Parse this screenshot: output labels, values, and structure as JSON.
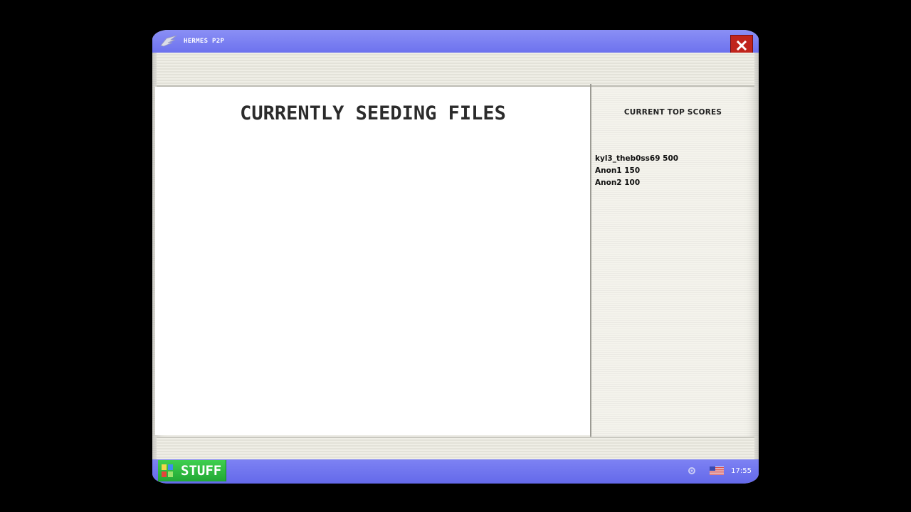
{
  "window": {
    "title": "HERMES P2P",
    "app_icon": "wing-icon",
    "close_icon": "close-icon"
  },
  "main": {
    "heading": "CURRENTLY SEEDING FILES"
  },
  "sidebar": {
    "heading": "CURRENT TOP SCORES",
    "scores": [
      {
        "text": "kyl3_theb0ss69 500"
      },
      {
        "text": "Anon1 150"
      },
      {
        "text": "Anon2 100"
      }
    ]
  },
  "taskbar": {
    "start_label": "STUFF",
    "start_icon": "stuff-menu-icon",
    "clock": "17:55",
    "tray_icons": [
      "settings-tray-icon",
      "flag-icon"
    ]
  },
  "colors": {
    "titlebar": "#7b80f1",
    "close": "#c0241c",
    "start": "#2fbd41"
  }
}
